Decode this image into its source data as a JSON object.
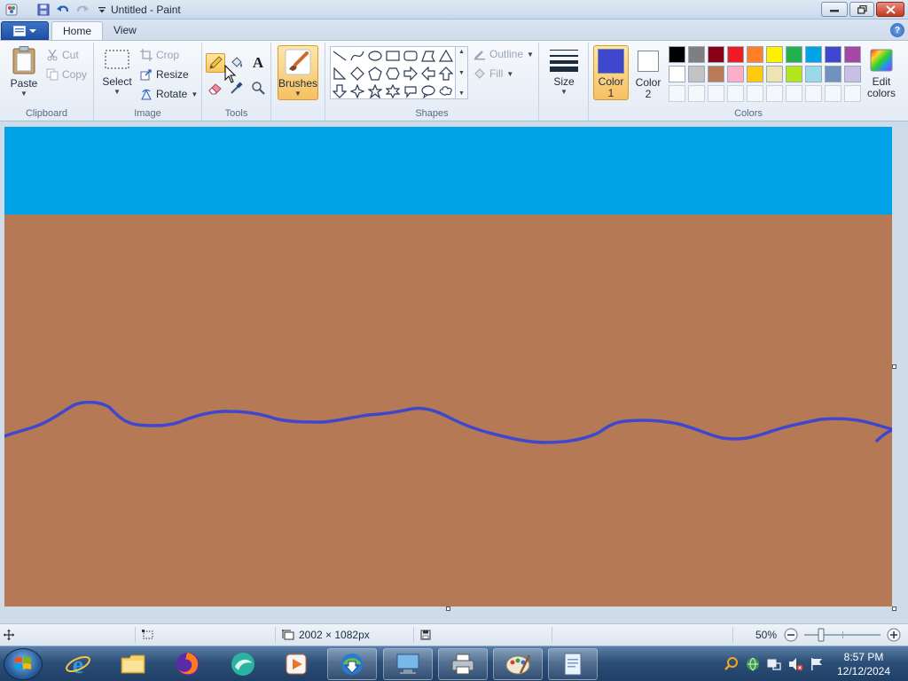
{
  "window": {
    "title": "Untitled - Paint"
  },
  "tabs": [
    {
      "label": "Home"
    },
    {
      "label": "View"
    }
  ],
  "ribbon": {
    "clipboard": {
      "label": "Clipboard",
      "paste": "Paste",
      "cut": "Cut",
      "copy": "Copy"
    },
    "image": {
      "label": "Image",
      "select": "Select",
      "crop": "Crop",
      "resize": "Resize",
      "rotate": "Rotate"
    },
    "tools": {
      "label": "Tools",
      "selected": "pencil"
    },
    "brushes": {
      "label": "Brushes"
    },
    "shapes": {
      "label": "Shapes",
      "outline": "Outline",
      "fill": "Fill"
    },
    "size": {
      "label": "Size"
    },
    "colors": {
      "label": "Colors",
      "color1_line1": "Color",
      "color1_line2": "1",
      "color2_line1": "Color",
      "color2_line2": "2",
      "color1": "#3f48cc",
      "color2": "#ffffff",
      "edit_line1": "Edit",
      "edit_line2": "colors",
      "palette_row1": [
        "#000000",
        "#7f7f7f",
        "#880015",
        "#ed1c24",
        "#ff7f27",
        "#fff200",
        "#22b14c",
        "#00a2e8",
        "#3f48cc",
        "#a349a4"
      ],
      "palette_row2": [
        "#ffffff",
        "#c3c3c3",
        "#b97a57",
        "#ffaec9",
        "#ffc90e",
        "#efe4b0",
        "#b5e61d",
        "#99d9ea",
        "#7092be",
        "#c8bfe7"
      ]
    }
  },
  "canvas": {
    "sky_color": "#00a2e8",
    "ground_color": "#b57a55",
    "line_color": "#3f48cc"
  },
  "status": {
    "dimensions": "2002 × 1082px",
    "zoom": "50%"
  },
  "taskbar": {
    "time": "8:57 PM",
    "date": "12/12/2024"
  }
}
